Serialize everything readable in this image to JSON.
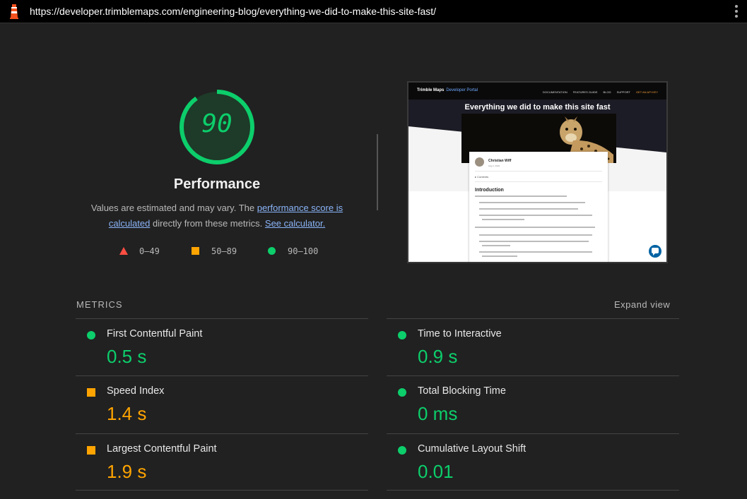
{
  "url": "https://developer.trimblemaps.com/engineering-blog/everything-we-did-to-make-this-site-fast/",
  "score": {
    "value": "90",
    "fraction": 0.9,
    "title": "Performance",
    "desc_prefix": "Values are estimated and may vary. The ",
    "desc_link1": "performance score is calculated",
    "desc_middle": " directly from these metrics. ",
    "desc_link2": "See calculator."
  },
  "legend": [
    {
      "icon": "triangle",
      "color": "#ff4e42",
      "label": "0–49"
    },
    {
      "icon": "square",
      "color": "#ffa400",
      "label": "50–89"
    },
    {
      "icon": "circle",
      "color": "#0cce6b",
      "label": "90–100"
    }
  ],
  "thumbnail": {
    "logo": "Trimble Maps",
    "logo_sub": "Developer Portal",
    "nav": [
      "DOCUMENTATION",
      "FEATURES GUIDE",
      "BLOG",
      "SUPPORT",
      "GET AN API KEY"
    ],
    "hero_title": "Everything we did to make this site fast",
    "author": "Christian Wiff",
    "date": "Aug 2, 2022",
    "contents": "▸ Contents",
    "intro": "Introduction"
  },
  "metrics_label": "METRICS",
  "expand_label": "Expand view",
  "metrics": [
    {
      "name": "First Contentful Paint",
      "value": "0.5 s",
      "rating": "good"
    },
    {
      "name": "Time to Interactive",
      "value": "0.9 s",
      "rating": "good"
    },
    {
      "name": "Speed Index",
      "value": "1.4 s",
      "rating": "average"
    },
    {
      "name": "Total Blocking Time",
      "value": "0 ms",
      "rating": "good"
    },
    {
      "name": "Largest Contentful Paint",
      "value": "1.9 s",
      "rating": "average"
    },
    {
      "name": "Cumulative Layout Shift",
      "value": "0.01",
      "rating": "good"
    }
  ],
  "colors": {
    "good": "#0cce6b",
    "average": "#ffa400",
    "poor": "#ff4e42",
    "link": "#8ab4f8"
  }
}
